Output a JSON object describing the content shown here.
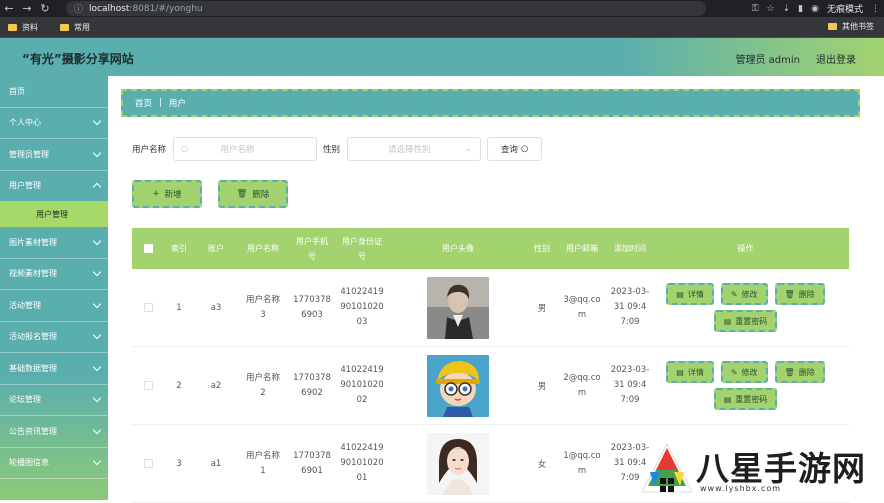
{
  "browser": {
    "url_host": "localhost",
    "url_rest": ":8081/#/yonghu",
    "incognito_label": "无痕模式",
    "bookmarks": [
      "资料",
      "常用"
    ],
    "other_bookmarks": "其他书签"
  },
  "header": {
    "title": "“有光”摄影分享网站",
    "admin_label": "管理员 admin",
    "logout_label": "退出登录"
  },
  "sidebar": {
    "items": [
      {
        "label": "首页",
        "chevron": false
      },
      {
        "label": "个人中心",
        "chevron": true
      },
      {
        "label": "管理员管理",
        "chevron": true
      },
      {
        "label": "用户管理",
        "chevron": true
      },
      {
        "label": "图片素材管理",
        "chevron": true
      },
      {
        "label": "视频素材管理",
        "chevron": true
      },
      {
        "label": "活动管理",
        "chevron": true
      },
      {
        "label": "活动报名管理",
        "chevron": true
      },
      {
        "label": "基础数据管理",
        "chevron": true
      },
      {
        "label": "论坛管理",
        "chevron": true
      },
      {
        "label": "公告资讯管理",
        "chevron": true
      },
      {
        "label": "轮播图信息",
        "chevron": true
      }
    ],
    "active_sub": "用户管理"
  },
  "breadcrumb": {
    "home": "首页",
    "current": "用户"
  },
  "search": {
    "username_label": "用户名称",
    "username_placeholder": "用户名称",
    "gender_label": "性别",
    "gender_placeholder": "请选择性别",
    "query_label": "查询"
  },
  "actions": {
    "add": "新增",
    "delete": "删除"
  },
  "table": {
    "headers": {
      "index": "索引",
      "account": "账户",
      "name": "用户名称",
      "phone": "用户手机号",
      "idcard": "用户身份证号",
      "avatar": "用户头像",
      "gender": "性别",
      "email": "用户邮箱",
      "time": "添加时间",
      "ops": "操作"
    },
    "rows": [
      {
        "index": "1",
        "account": "a3",
        "name": "用户名称3",
        "phone": "17703786903",
        "idcard": "410224199010102003",
        "gender": "男",
        "email": "3@qq.com",
        "time": "2023-03-31 09:47:09"
      },
      {
        "index": "2",
        "account": "a2",
        "name": "用户名称2",
        "phone": "17703786902",
        "idcard": "410224199010102002",
        "gender": "男",
        "email": "2@qq.com",
        "time": "2023-03-31 09:47:09"
      },
      {
        "index": "3",
        "account": "a1",
        "name": "用户名称1",
        "phone": "17703786901",
        "idcard": "410224199010102001",
        "gender": "女",
        "email": "1@qq.com",
        "time": "2023-03-31 09:47:09"
      }
    ],
    "op_labels": {
      "detail": "详情",
      "edit": "修改",
      "delete": "删除",
      "reset": "重置密码"
    }
  },
  "watermark": {
    "text": "八星手游网",
    "url": "www.lyshbx.com"
  },
  "colors": {
    "teal": "#5aaeae",
    "green": "#a3d36f"
  }
}
